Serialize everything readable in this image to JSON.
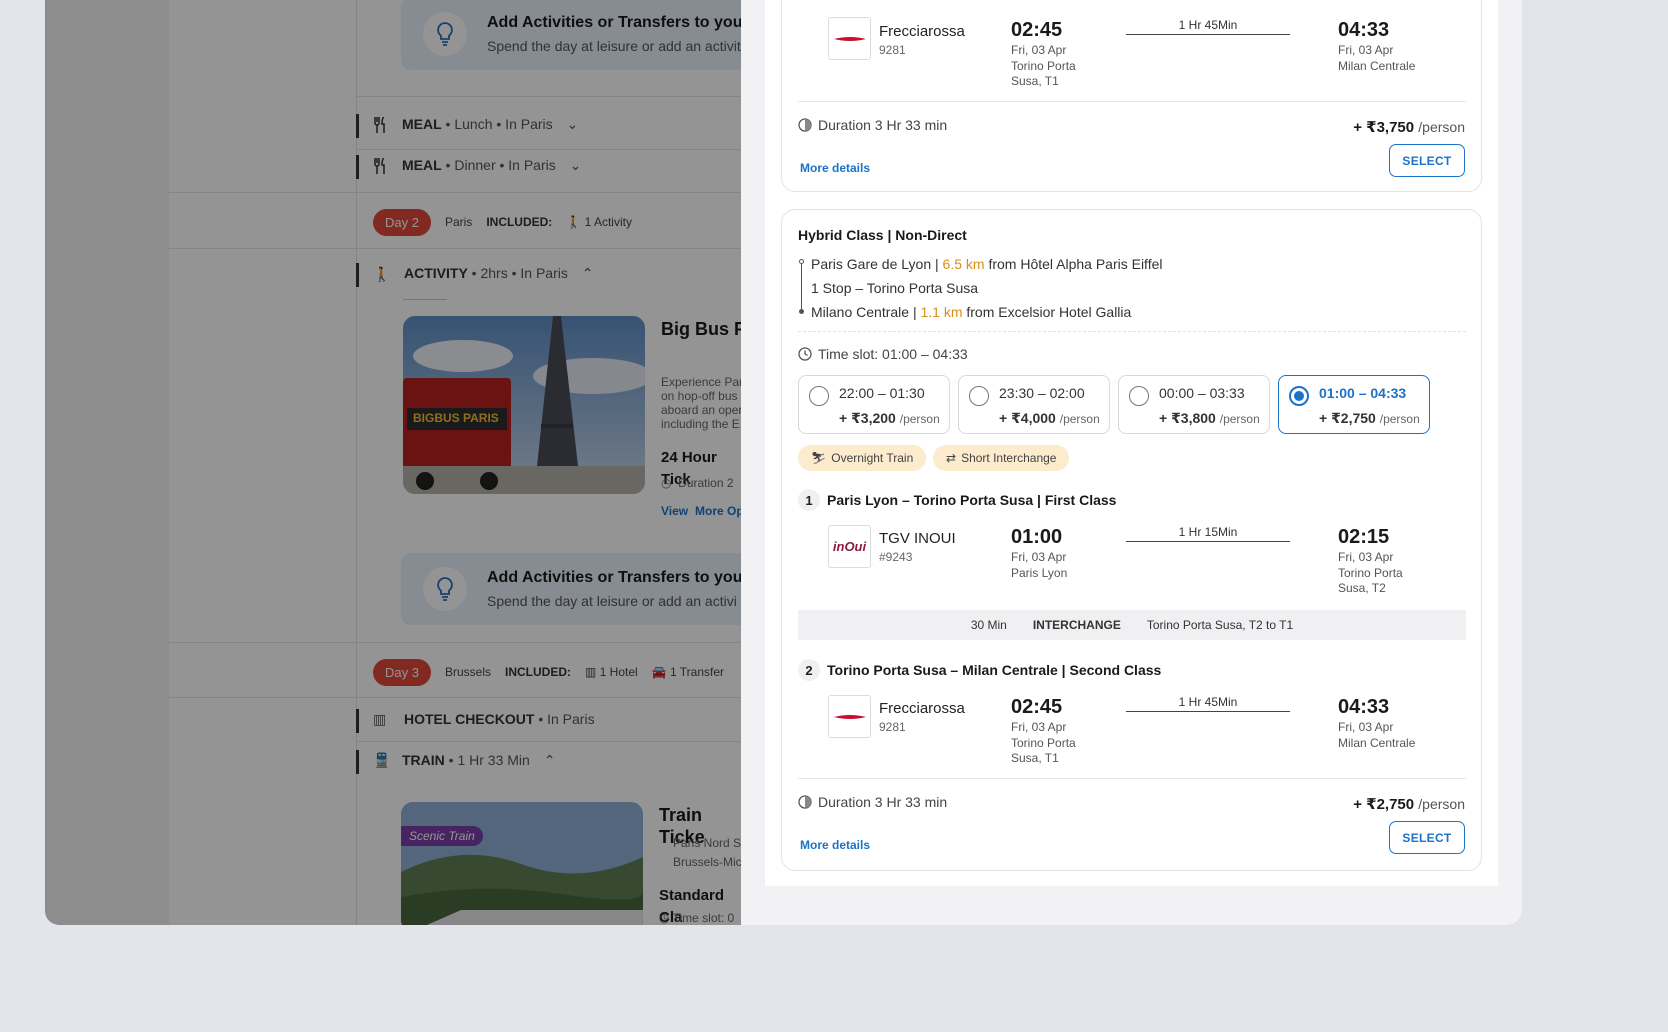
{
  "background": {
    "add_activity": {
      "title": "Add Activities or Transfers to your",
      "subtitle": "Spend the day at leisure or add an activit"
    },
    "add_activity_2": {
      "title": "Add Activities or Transfers to your",
      "subtitle": "Spend the day at leisure or add an activi"
    },
    "meal_lunch": {
      "label": "MEAL",
      "detail": "Lunch • In Paris"
    },
    "meal_dinner": {
      "label": "MEAL",
      "detail": "Dinner • In Paris"
    },
    "day2": {
      "pill": "Day 2",
      "city": "Paris",
      "included": "INCLUDED:",
      "items": "1 Activity"
    },
    "activity": {
      "label": "ACTIVITY",
      "detail": "2hrs • In Paris"
    },
    "activity_card": {
      "title": "Big Bus P Cruise",
      "desc_lines": [
        "Experience Par",
        "on hop-off bus",
        "aboard an oper",
        "including the E"
      ],
      "ticket": "24 Hour Tick",
      "duration": "Duration 2",
      "link_view": "View",
      "link_more": "More Op",
      "photo_text": "BIGBUS PARIS"
    },
    "day3": {
      "pill": "Day 3",
      "city": "Brussels",
      "included": "INCLUDED:",
      "hotel": "1 Hotel",
      "transfer": "1 Transfer"
    },
    "hotel_checkout": {
      "label": "HOTEL CHECKOUT",
      "detail": "• In Paris"
    },
    "train": {
      "label": "TRAIN",
      "detail": "1 Hr 33 Min"
    },
    "train_card": {
      "title": "Train Ticke",
      "from": "Paris Nord S",
      "to": "Brussels-Mic",
      "class": "Standard Cla",
      "slot": "Time slot: 0",
      "badge": "Scenic Train"
    }
  },
  "option1": {
    "operator": "Frecciarossa",
    "number": "9281",
    "dep_time": "02:45",
    "dep_date": "Fri, 03 Apr",
    "dep_station_1": "Torino Porta",
    "dep_station_2": "Susa, T1",
    "duration_label": "1 Hr 45Min",
    "arr_time": "04:33",
    "arr_date": "Fri, 03 Apr",
    "arr_station": "Milan Centrale",
    "total_duration": "Duration 3 Hr 33 min",
    "price": "+ ₹3,750",
    "per": "/person",
    "more_details": "More details",
    "select": "SELECT"
  },
  "option2": {
    "class_title": "Hybrid Class | Non-Direct",
    "route": {
      "from_station": "Paris Gare de Lyon |",
      "from_km": "6.5 km",
      "from_hotel": "from Hôtel Alpha Paris Eiffel",
      "stop": "1 Stop – Torino Porta Susa",
      "to_station": "Milano Centrale |",
      "to_km": "1.1 km",
      "to_hotel": "from Excelsior Hotel Gallia"
    },
    "time_slot": "Time slot: 01:00 – 04:33",
    "slots": [
      {
        "range": "22:00 – 01:30",
        "price": "+ ₹3,200",
        "per": "/person",
        "selected": false
      },
      {
        "range": "23:30 – 02:00",
        "price": "+ ₹4,000",
        "per": "/person",
        "selected": false
      },
      {
        "range": "00:00 – 03:33",
        "price": "+ ₹3,800",
        "per": "/person",
        "selected": false
      },
      {
        "range": "01:00 – 04:33",
        "price": "+ ₹2,750",
        "per": "/person",
        "selected": true
      }
    ],
    "tags": [
      "Overnight Train",
      "Short Interchange"
    ],
    "legs": [
      {
        "num": "1",
        "title": "Paris Lyon – Torino Porta Susa | First Class",
        "operator": "TGV INOUI",
        "number": "#9243",
        "logo_text": "inOui",
        "dep_time": "01:00",
        "dep_date": "Fri, 03 Apr",
        "dep_station_1": "Paris Lyon",
        "dep_station_2": "",
        "duration_label": "1 Hr 15Min",
        "arr_time": "02:15",
        "arr_date": "Fri, 03 Apr",
        "arr_station_1": "Torino Porta",
        "arr_station_2": "Susa, T2"
      },
      {
        "num": "2",
        "title": "Torino Porta Susa – Milan Centrale | Second Class",
        "operator": "Frecciarossa",
        "number": "9281",
        "dep_time": "02:45",
        "dep_date": "Fri, 03 Apr",
        "dep_station_1": "Torino Porta",
        "dep_station_2": "Susa, T1",
        "duration_label": "1 Hr 45Min",
        "arr_time": "04:33",
        "arr_date": "Fri, 03 Apr",
        "arr_station_1": "Milan Centrale",
        "arr_station_2": ""
      }
    ],
    "interchange": {
      "time": "30 Min",
      "label": "INTERCHANGE",
      "where": "Torino Porta Susa, T2 to T1"
    },
    "total_duration": "Duration 3 Hr 33 min",
    "price": "+ ₹2,750",
    "per": "/person",
    "more_details": "More details",
    "select": "SELECT"
  },
  "colors": {
    "accent": "#1a73c8",
    "km": "#d98e1c",
    "day_pill": "#e0473b",
    "tag_bg": "#fcebcd"
  }
}
